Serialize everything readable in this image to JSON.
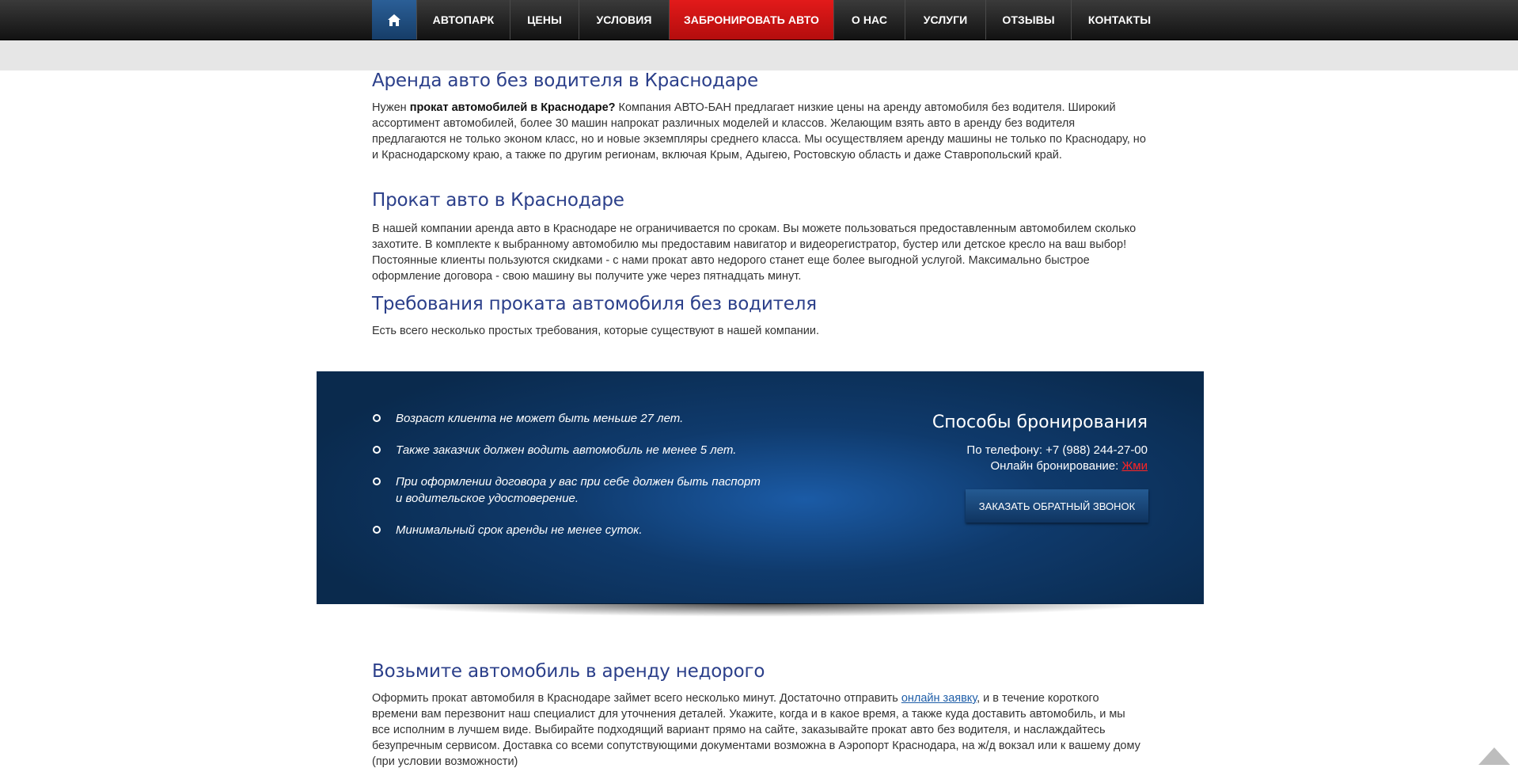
{
  "nav": {
    "items": [
      "АВТОПАРК",
      "ЦЕНЫ",
      "УСЛОВИЯ",
      "ЗАБРОНИРОВАТЬ АВТО",
      "О НАС",
      "УСЛУГИ",
      "ОТЗЫВЫ",
      "КОНТАКТЫ"
    ],
    "home_icon": "home-icon",
    "book_color": "#d81414",
    "home_color": "#1f4d80"
  },
  "section1": {
    "heading": "Аренда авто без водителя в Краснодаре",
    "p_prefix": "Нужен ",
    "p_bold": "прокат автомобилей в Краснодаре?",
    "p_rest": " Компания АВТО-БАН предлагает низкие цены на аренду автомобиля без водителя. Широкий ассортимент автомобилей, более 30 машин напрокат различных моделей и классов. Желающим взять авто в аренду без водителя предлагаются не только эконом класс, но и новые экземпляры среднего класса. Мы осуществляем аренду машины не только по Краснодару, но и Краснодарскому краю, а также по другим регионам, включая Крым, Адыгею, Ростовскую область и даже Ставропольский край."
  },
  "section2": {
    "heading": "Прокат авто в Краснодаре",
    "paragraph": "В нашей компании аренда авто в Краснодаре не ограничивается по срокам. Вы можете пользоваться предоставленным автомобилем сколько захотите. В комплекте к выбранному автомобилю мы предоставим навигатор и видеорегистратор, бустер или детское кресло на ваш выбор! Постоянные клиенты пользуются скидками - с нами прокат авто недорого станет еще более выгодной услугой. Максимально быстрое оформление договора - свою машину вы получите уже через пятнадцать минут."
  },
  "section3": {
    "heading": "Требования проката автомобиля без водителя",
    "paragraph": "Есть всего несколько простых требования, которые существуют в нашей компании."
  },
  "requirements": [
    "Возраст клиента не может быть меньше 27 лет.",
    "Также заказчик должен водить автомобиль не менее 5 лет.",
    "При оформлении договора у вас при себе должен быть паспорт и водительское удостоверение.",
    "Минимальный срок аренды не менее суток."
  ],
  "booking": {
    "title": "Способы бронирования",
    "phone_line": "По телефону: +7 (988) 244-27-00",
    "online_prefix": "Онлайн бронирование: ",
    "online_link": "Жми",
    "callback_button": "ЗАКАЗАТЬ ОБРАТНЫЙ ЗВОНОК"
  },
  "section4": {
    "heading": "Возьмите автомобиль в аренду недорого",
    "p_prefix": "Оформить прокат автомобиля в Краснодаре займет всего несколько минут. Достаточно отправить ",
    "p_link": "онлайн заявку",
    "p_rest": ", и в течение короткого времени вам перезвонит наш специалист для уточнения деталей. Укажите, когда и в какое время, а также куда доставить автомобиль, и мы все исполним в лучшем виде. Выбирайте подходящий вариант прямо на сайте, заказывайте прокат авто без водителя, и наслаждайтесь безупречным сервисом. Доставка со всеми сопутствующими документами возможна в Аэропорт Краснодара, на ж/д вокзал или к вашему дому (при условии возможности)"
  },
  "scroll_top_icon": "arrow-up-icon"
}
